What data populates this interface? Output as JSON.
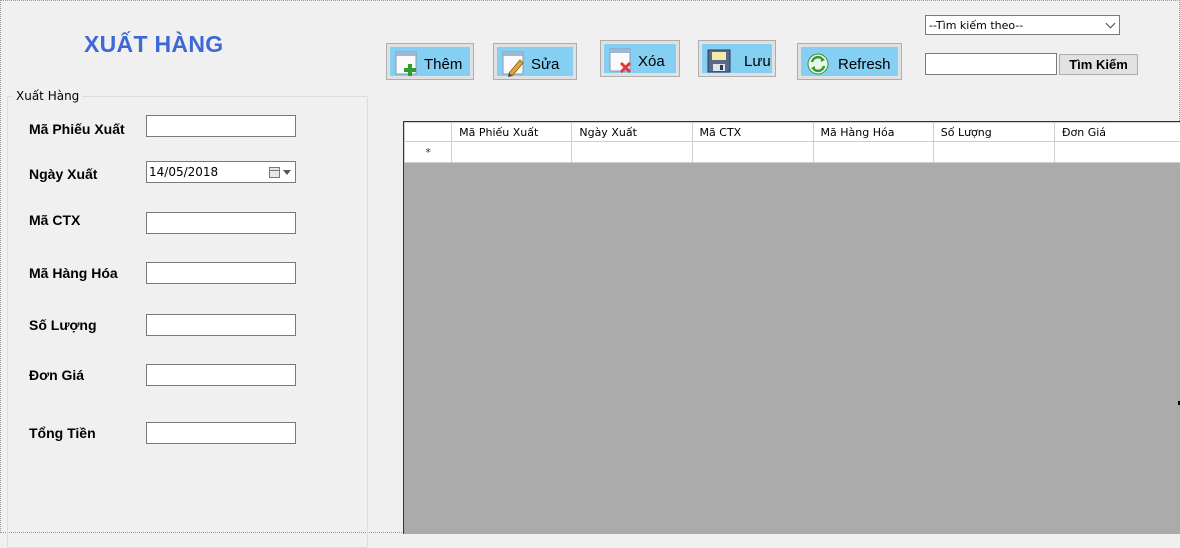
{
  "window": {
    "title": "XUẤT HÀNG"
  },
  "group": {
    "legend": "Xuất Hàng",
    "fields": {
      "ma_phieu_xuat": {
        "label": "Mã Phiếu Xuất",
        "value": ""
      },
      "ngay_xuat": {
        "label": "Ngày Xuất",
        "value": "14/05/2018"
      },
      "ma_ctx": {
        "label": "Mã CTX",
        "value": ""
      },
      "ma_hang_hoa": {
        "label": "Mã Hàng Hóa",
        "value": ""
      },
      "so_luong": {
        "label": "Số Lượng",
        "value": ""
      },
      "don_gia": {
        "label": "Đơn Giá",
        "value": ""
      },
      "tong_tien": {
        "label": "Tổng Tiền",
        "value": ""
      }
    }
  },
  "toolbar": {
    "them": "Thêm",
    "sua": "Sửa",
    "xoa": "Xóa",
    "luu": "Lưu",
    "refresh": "Refresh",
    "icons": [
      "add-icon",
      "edit-icon",
      "delete-icon",
      "save-icon",
      "refresh-icon"
    ]
  },
  "search": {
    "combo_selected": "--Tìm kiếm theo--",
    "input_value": "",
    "button": "Tìm Kiếm"
  },
  "grid": {
    "columns": [
      "Mã Phiếu Xuất",
      "Ngày Xuất",
      "Mã CTX",
      "Mã Hàng Hóa",
      "Số Lượng",
      "Đơn Giá"
    ],
    "new_row_marker": "*"
  },
  "colors": {
    "title": "#3e68d6",
    "button_face": "#85cff3",
    "grid_background": "#ababab"
  }
}
